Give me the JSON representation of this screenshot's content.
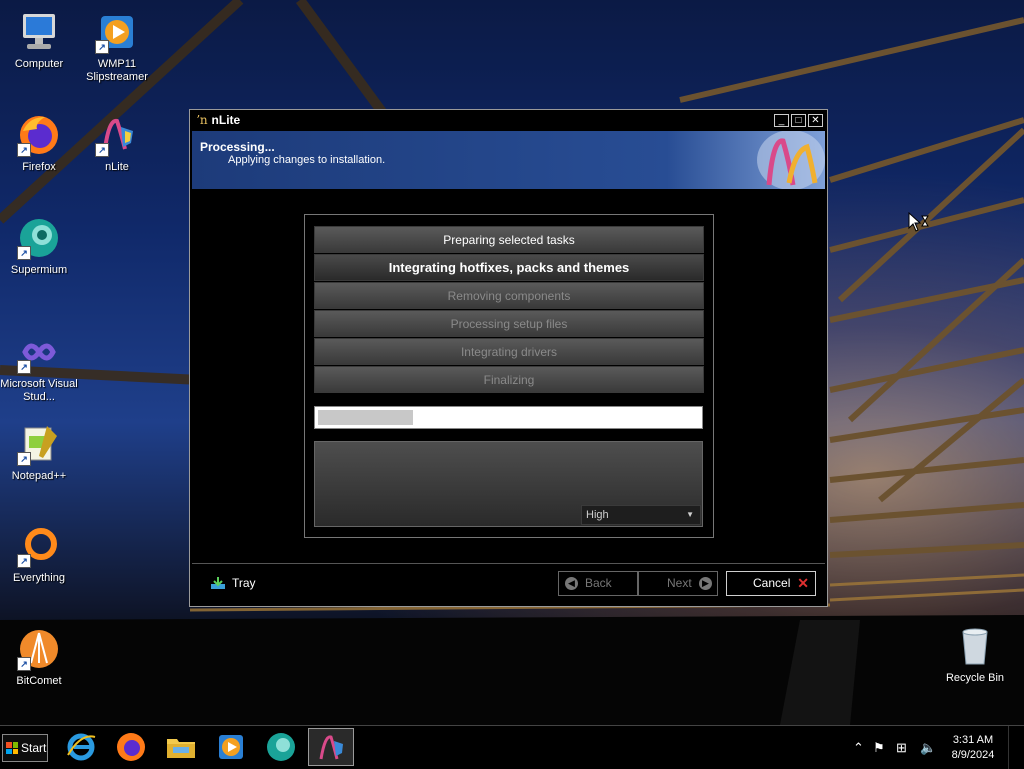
{
  "desktop": {
    "icons": [
      {
        "label": "Computer"
      },
      {
        "label": "WMP11 Slipstreamer"
      },
      {
        "label": "Firefox"
      },
      {
        "label": "nLite"
      },
      {
        "label": "Supermium"
      },
      {
        "label": "Microsoft Visual Stud..."
      },
      {
        "label": "Notepad++"
      },
      {
        "label": "Everything"
      },
      {
        "label": "BitComet"
      },
      {
        "label": "Recycle Bin"
      }
    ]
  },
  "window": {
    "title": "nLite",
    "banner_title": "Processing...",
    "banner_subtitle": "Applying changes to installation.",
    "tasks": [
      {
        "label": "Preparing selected tasks",
        "state": "done"
      },
      {
        "label": "Integrating hotfixes, packs and themes",
        "state": "active"
      },
      {
        "label": "Removing components",
        "state": "pending"
      },
      {
        "label": "Processing setup files",
        "state": "pending"
      },
      {
        "label": "Integrating drivers",
        "state": "pending"
      },
      {
        "label": "Finalizing",
        "state": "pending"
      }
    ],
    "progress_fraction": 0.25,
    "priority_value": "High",
    "tray_label": "Tray",
    "back_label": "Back",
    "next_label": "Next",
    "cancel_label": "Cancel"
  },
  "taskbar": {
    "start_label": "Start",
    "time": "3:31 AM",
    "date": "8/9/2024"
  }
}
